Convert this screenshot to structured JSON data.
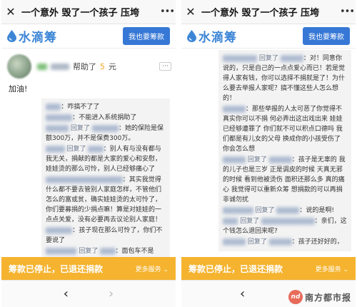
{
  "header": {
    "title": "一个意外 毁了一个孩子 压垮",
    "close_icon": "close-icon",
    "menu_icon": "more-dots-icon"
  },
  "brand": {
    "name": "水滴筹",
    "raise_button": "我也要筹款",
    "color": "#3778d6"
  },
  "left": {
    "donor": {
      "helped_text": "帮助了",
      "amount": "5",
      "unit": "元",
      "message": "加油!"
    },
    "comments": [
      {
        "name": "xxxx",
        "text": "咋搞不了了"
      },
      {
        "name": "xxxxxxx",
        "text": "不能进入系统捐助了"
      },
      {
        "name": "xxxxxx",
        "reply_word": "回复了",
        "target": "xxxxxxx",
        "text": "她的保险是保额300万，并不是保费300万。"
      },
      {
        "name": "xxxxx",
        "reply_word": "回复了",
        "target": "xxxx",
        "text": "别人有与没有都与我无关，捐献的都是大家的爱心和安慰，娃娃烫的那么可怜，别人已经够痛心了"
      },
      {
        "name": "xxxxxxxxxxxxxxxxx853",
        "text": "其实我觉得什么都不要去管别人家庭怎样，不管他们怎么的富或贫，确实娃娃烫的太可怜了，你们要募捐的少捐点嘛！算是对娃娃的一点点关爱，没有必要再去议论别人家庭！"
      },
      {
        "name": "xxxxxxx",
        "text": "孩子现在那么可怜了，你们不要说了"
      },
      {
        "name": "Axxxxxxx",
        "reply_word": "回复了",
        "target": "xxxx",
        "text": "面包车不是"
      }
    ]
  },
  "right": {
    "comments": [
      {
        "name": "xxxxxxxxx",
        "reply_word": "回复了",
        "target": "xxxxxY",
        "text": "对！同意你说的，只是自己的一点点爱心而已！若是觉得人家有钱，你可以选择不捐就是了！为什么要去举报人家呢？搞不懂这些人怎么想的！"
      },
      {
        "name": "xxxxxx",
        "text": "那些举报的人太可恶了你觉得不真实你可以不捐 何必弄出这出戏出来 娃娃已经够遭罪了 你们就不可以积点口德吗 我们都是有儿女的父母 换成你的小孩受伤了 你会怎么想"
      },
      {
        "name": "xxxxxx",
        "reply_word": "回复了",
        "target": "xxxxxx",
        "text": "孩子是无辜的 我的儿子也是三岁 正是调皮的时候 天真无邪的时候 看到他被烫伤 面积还那么多 真的痛心 我觉得可以重新众筹 想捐款的可以再捐 非诚勿扰"
      },
      {
        "name": "xxxxxxxx",
        "reply_word": "回复了",
        "target": "xxxxxx",
        "text": "说的是啊!"
      },
      {
        "name": "xxxx",
        "reply_word": "回复了",
        "target": "xxxxxxxxxxxxxx",
        "text": "亲们，这个钱怎么退回来呢?"
      },
      {
        "name": "xxxxxx",
        "reply_word": "回复了",
        "target": "xxxxxx",
        "text": "孩子还好好的，"
      }
    ]
  },
  "footer": {
    "status": "筹款已停止，已退还捐款",
    "more_services": "更多服务 ⌄",
    "status_color": "#f5b32f"
  },
  "nav": {
    "back_icon": "back-arrow-icon",
    "forward_icon": "forward-arrow-icon"
  },
  "watermark": {
    "logo_text": "nd",
    "text": "南方都市报"
  }
}
